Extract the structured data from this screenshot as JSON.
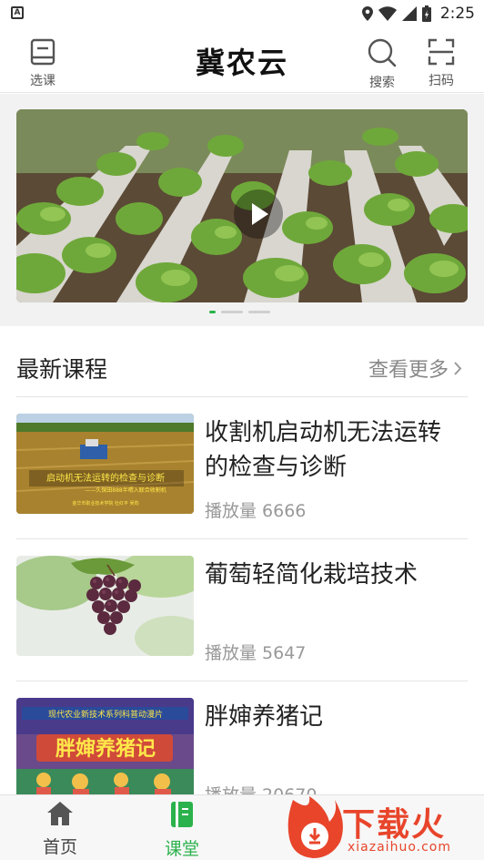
{
  "status_bar": {
    "time": "2:25",
    "left_icon": "A"
  },
  "header": {
    "title": "冀农云",
    "left_button": {
      "label": "选课",
      "icon": "book-icon"
    },
    "search_button": {
      "label": "搜索",
      "icon": "search-icon"
    },
    "scan_button": {
      "label": "扫码",
      "icon": "scan-icon"
    }
  },
  "banner": {
    "slide_count": 3,
    "active_slide": 1
  },
  "latest": {
    "title": "最新课程",
    "more_label": "查看更多",
    "courses": [
      {
        "title": "收割机启动机无法运转的检查与诊断",
        "plays": "播放量 6666",
        "thumb_title": "启动机无法运转的检查与诊断",
        "thumb_subtitle": "——久保田888半喂入联合收割机",
        "thumb_credit": "金华市职业技术学院 杜红平 吴昀"
      },
      {
        "title": "葡萄轻简化栽培技术",
        "plays": "播放量 5647"
      },
      {
        "title": "胖婶养猪记",
        "plays": "播放量 20670",
        "thumb_banner": "现代农业新技术系列科普动漫片",
        "thumb_title": "胖婶养猪记"
      }
    ]
  },
  "tabs": [
    {
      "label": "首页",
      "icon": "home-icon",
      "active": false
    },
    {
      "label": "课堂",
      "icon": "classroom-icon",
      "active": true
    }
  ],
  "watermark": {
    "text": "下载火",
    "sub": "xiazaihuo.com"
  },
  "colors": {
    "accent": "#2bb24c",
    "text": "#222222",
    "muted": "#999999"
  }
}
